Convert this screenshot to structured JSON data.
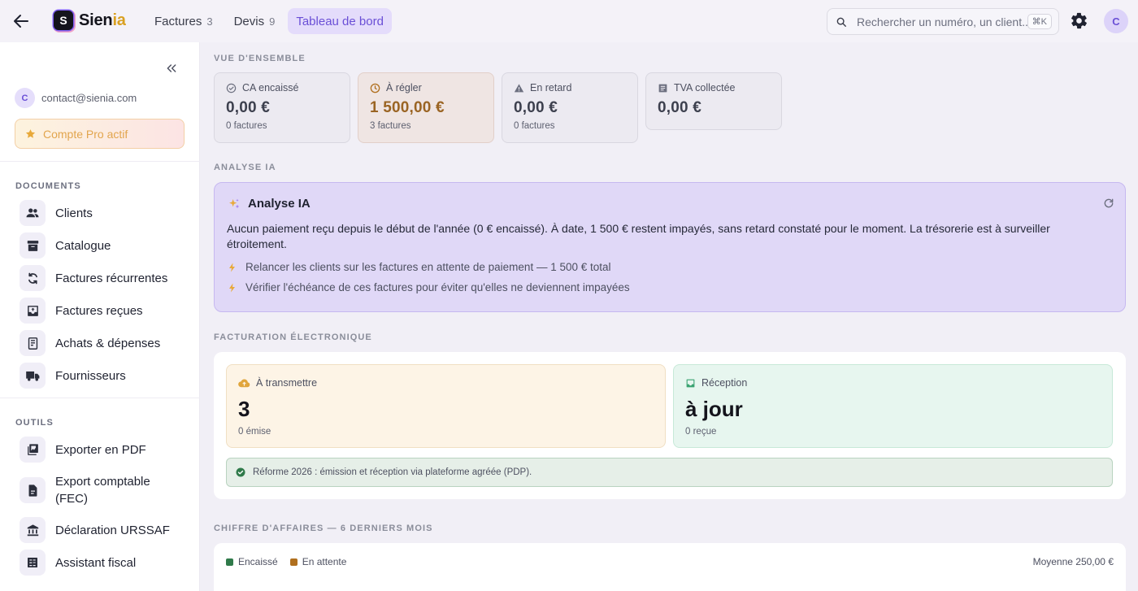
{
  "app": {
    "brand_prefix": "Sien",
    "brand_suffix": "ia",
    "logo_letter": "S",
    "accent_color": "#6a4fd6"
  },
  "nav": {
    "tabs": [
      {
        "label": "Factures",
        "count": "3",
        "active": false
      },
      {
        "label": "Devis",
        "count": "9",
        "active": false
      },
      {
        "label": "Tableau de bord",
        "count": "",
        "active": true
      }
    ]
  },
  "search": {
    "placeholder": "Rechercher un numéro, un client...",
    "shortcut": "⌘K"
  },
  "user": {
    "initial": "C",
    "email": "contact@sienia.com"
  },
  "sidebar": {
    "pro_badge": "Compte Pro actif",
    "documents_title": "DOCUMENTS",
    "documents": [
      {
        "label": "Clients",
        "icon": "users-icon"
      },
      {
        "label": "Catalogue",
        "icon": "archive-icon"
      },
      {
        "label": "Factures récurrentes",
        "icon": "recurring-icon"
      },
      {
        "label": "Factures reçues",
        "icon": "inbox-icon"
      },
      {
        "label": "Achats & dépenses",
        "icon": "receipt-icon"
      },
      {
        "label": "Fournisseurs",
        "icon": "truck-icon"
      }
    ],
    "tools_title": "OUTILS",
    "tools": [
      {
        "label": "Exporter en PDF",
        "icon": "pdf-icon"
      },
      {
        "label": "Export comptable (FEC)",
        "icon": "document-icon"
      },
      {
        "label": "Déclaration URSSAF",
        "icon": "bank-icon"
      },
      {
        "label": "Assistant fiscal",
        "icon": "calculator-icon"
      }
    ]
  },
  "overview": {
    "title": "VUE D'ENSEMBLE",
    "kpis": [
      {
        "label": "CA encaissé",
        "value": "0,00 €",
        "sub": "0 factures",
        "icon": "check-circle-icon"
      },
      {
        "label": "À régler",
        "value": "1 500,00 €",
        "sub": "3 factures",
        "icon": "clock-icon"
      },
      {
        "label": "En retard",
        "value": "0,00 €",
        "sub": "0 factures",
        "icon": "warning-icon"
      },
      {
        "label": "TVA collectée",
        "value": "0,00 €",
        "sub": "",
        "icon": "list-icon"
      }
    ]
  },
  "ai": {
    "section_title": "ANALYSE IA",
    "title": "Analyse IA",
    "summary": "Aucun paiement reçu depuis le début de l'année (0 € encaissé). À date, 1 500 € restent impayés, sans retard constaté pour le moment. La trésorerie est à surveiller étroitement.",
    "bullets": [
      "Relancer les clients sur les factures en attente de paiement — 1 500 € total",
      "Vérifier l'échéance de ces factures pour éviter qu'elles ne deviennent impayées"
    ]
  },
  "einvoicing": {
    "title": "FACTURATION ÉLECTRONIQUE",
    "to_send": {
      "label": "À transmettre",
      "value": "3",
      "sub": "0 émise"
    },
    "reception": {
      "label": "Réception",
      "value": "à jour",
      "sub": "0 reçue"
    },
    "notice": "Réforme 2026 : émission et réception via plateforme agréée (PDP)."
  },
  "revenue": {
    "title": "CHIFFRE D'AFFAIRES — 6 DERNIERS MOIS",
    "legend": [
      {
        "label": "Encaissé",
        "color": "#2f7a4a"
      },
      {
        "label": "En attente",
        "color": "#b06f1e"
      }
    ],
    "average": "Moyenne 250,00 €"
  }
}
